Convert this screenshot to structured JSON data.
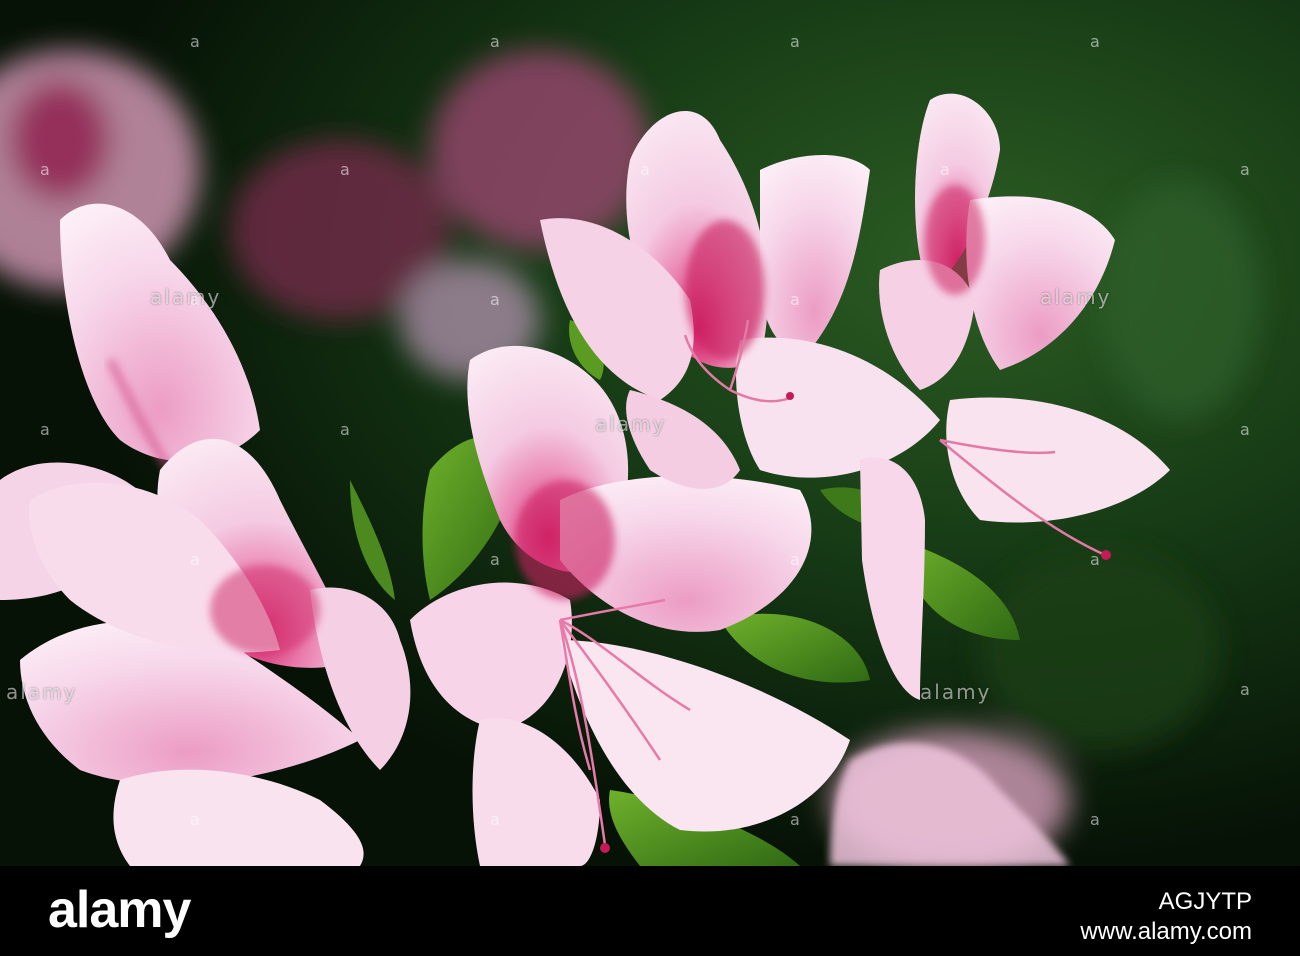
{
  "watermark": {
    "text": "alamy",
    "pair_text": "a"
  },
  "footer": {
    "brand": "alamy",
    "stock_id": "AGJYTP",
    "stock_url": "www.alamy.com"
  },
  "colors": {
    "petal_light": "#f7d9ec",
    "petal_pink": "#efb6d7",
    "petal_center": "#c81e5b",
    "leaf": "#4c8a1f",
    "background_dark": "#0e2a10"
  }
}
